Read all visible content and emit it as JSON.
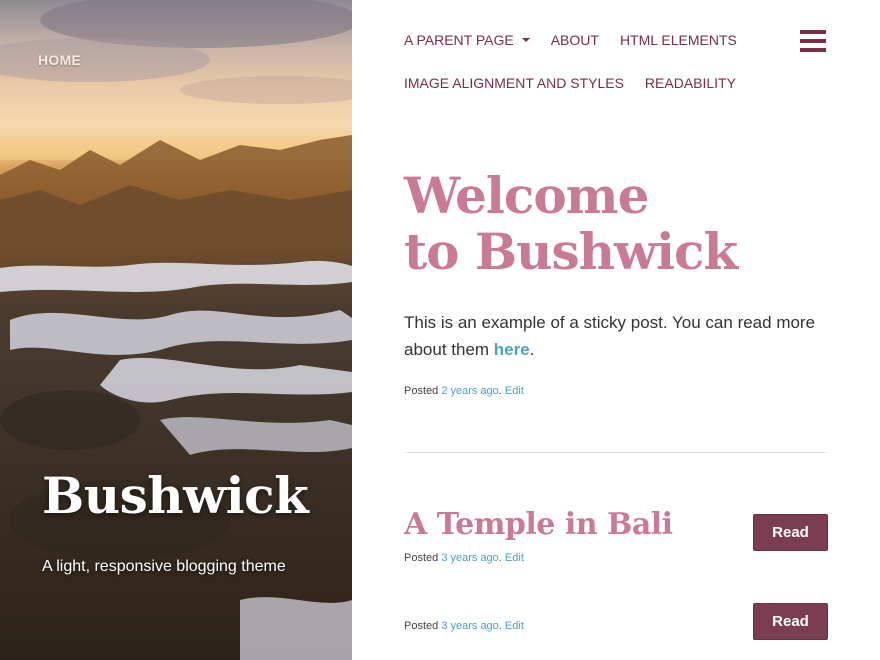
{
  "hero": {
    "home_link": "HOME",
    "site_title": "Bushwick",
    "tagline": "A light, responsive blogging theme"
  },
  "nav": {
    "items": [
      "A PARENT PAGE",
      "ABOUT",
      "HTML ELEMENTS",
      "IMAGE ALIGNMENT AND STYLES",
      "READABILITY"
    ],
    "menu_icon": "hamburger-menu-icon"
  },
  "sticky_post": {
    "title_line1": "Welcome",
    "title_line2": "to Bushwick",
    "excerpt_text": "This is an example of a sticky post. You can read more about them",
    "excerpt_link": "here",
    "excerpt_end": ".",
    "meta_prefix": "Posted",
    "meta_time": "2 years ago",
    "meta_sep": ".",
    "meta_edit": "Edit"
  },
  "posts": [
    {
      "title": "A Temple in Bali",
      "meta_prefix": "Posted",
      "meta_time": "3 years ago",
      "meta_sep": ".",
      "meta_edit": "Edit",
      "read_label": "Read"
    },
    {
      "title": "",
      "meta_prefix": "Posted",
      "meta_time": "3 years ago",
      "meta_sep": ".",
      "meta_edit": "Edit",
      "read_label": "Read"
    }
  ],
  "colors": {
    "accent": "#7a2e48",
    "title": "#c97b96",
    "link": "#4aa3c6",
    "button": "#7b3d52"
  }
}
